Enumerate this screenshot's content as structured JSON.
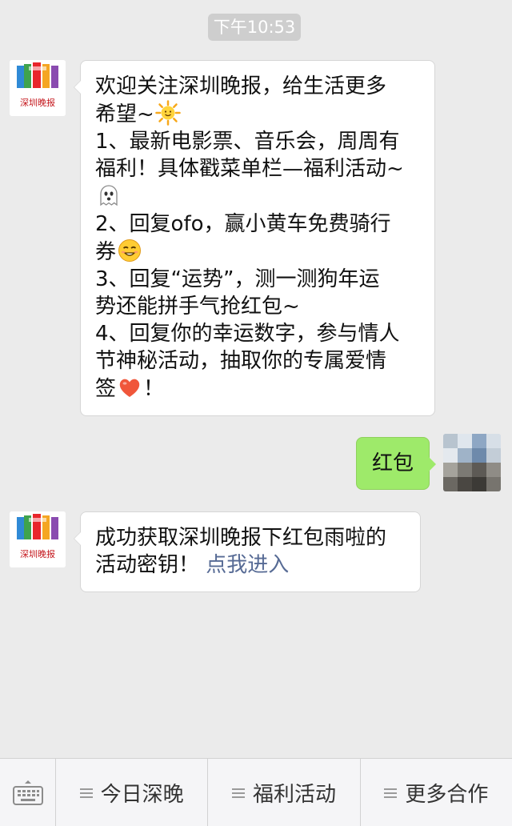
{
  "timestamp": "下午10:53",
  "messages": {
    "welcome": {
      "line1": "欢迎关注深圳晚报，给生活更多",
      "line2": "希望~",
      "line3": "1、最新电影票、音乐会，周周有",
      "line4": "福利！具体戳菜单栏—福利活动~",
      "line6": "2、回复ofo，赢小黄车免费骑行",
      "line7": "券",
      "line8": "3、回复“运势”，测一测狗年运",
      "line9": "势还能拼手气抢红包~",
      "line10": "4、回复你的幸运数字，参与情人",
      "line11": "节神秘活动，抽取你的专属爱情",
      "line12a": "签",
      "line12b": "！"
    },
    "user_reply": "红包",
    "key": {
      "line1": "成功获取深圳晚报下红包雨啦的",
      "line2a": "活动密钥！",
      "link": "点我进入"
    }
  },
  "avatar": {
    "logo_text": "深圳晚报"
  },
  "bottom_menu": {
    "items": [
      "今日深晚",
      "福利活动",
      "更多合作"
    ]
  },
  "icons": {
    "emoji_sun": "sun-emoji-icon",
    "emoji_ghost": "ghost-emoji-icon",
    "emoji_wink": "wink-emoji-icon",
    "emoji_heart": "heart-emoji-icon",
    "keyboard": "keyboard-icon",
    "menu": "menu-lines-icon"
  },
  "colors": {
    "background": "#ebebeb",
    "user_bubble": "#9eea6a",
    "link": "#576b95",
    "time_badge": "#cecece"
  }
}
